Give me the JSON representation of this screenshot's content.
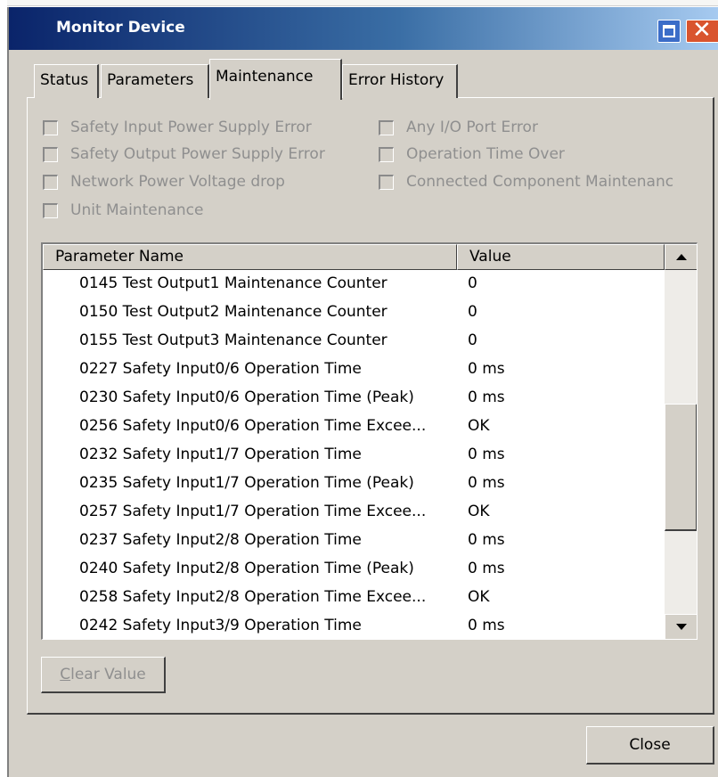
{
  "window": {
    "title": "Monitor Device"
  },
  "tabs": [
    {
      "label": "Status",
      "active": false
    },
    {
      "label": "Parameters",
      "active": false
    },
    {
      "label": "Maintenance",
      "active": true
    },
    {
      "label": "Error History",
      "active": false
    }
  ],
  "checks": [
    {
      "label": "Safety Input Power Supply Error",
      "checked": false,
      "enabled": false
    },
    {
      "label": "Safety Output Power Supply Error",
      "checked": false,
      "enabled": false
    },
    {
      "label": "Network Power Voltage drop",
      "checked": false,
      "enabled": false
    },
    {
      "label": "Unit Maintenance",
      "checked": false,
      "enabled": false
    },
    {
      "label": "Any I/O Port Error",
      "checked": false,
      "enabled": false
    },
    {
      "label": "Operation Time Over",
      "checked": false,
      "enabled": false
    },
    {
      "label": "Connected Component Maintenanc",
      "checked": false,
      "enabled": false
    }
  ],
  "table": {
    "columns": [
      "Parameter Name",
      "Value"
    ],
    "rows": [
      [
        "0145 Test Output1 Maintenance Counter",
        "0"
      ],
      [
        "0150 Test Output2 Maintenance Counter",
        "0"
      ],
      [
        "0155 Test Output3 Maintenance Counter",
        "0"
      ],
      [
        "0227 Safety Input0/6 Operation Time",
        "0 ms"
      ],
      [
        "0230 Safety Input0/6 Operation Time (Peak)",
        "0 ms"
      ],
      [
        "0256 Safety Input0/6 Operation Time Excee...",
        "OK"
      ],
      [
        "0232 Safety Input1/7 Operation Time",
        "0 ms"
      ],
      [
        "0235 Safety Input1/7 Operation Time (Peak)",
        "0 ms"
      ],
      [
        "0257 Safety Input1/7 Operation Time Excee...",
        "OK"
      ],
      [
        "0237 Safety Input2/8 Operation Time",
        "0 ms"
      ],
      [
        "0240 Safety Input2/8 Operation Time (Peak)",
        "0 ms"
      ],
      [
        "0258 Safety Input2/8 Operation Time Excee...",
        "OK"
      ],
      [
        "0242 Safety Input3/9 Operation Time",
        "0 ms"
      ]
    ]
  },
  "buttons": {
    "clear_value_accel": "C",
    "clear_value_rest": "lear Value",
    "close": "Close"
  }
}
